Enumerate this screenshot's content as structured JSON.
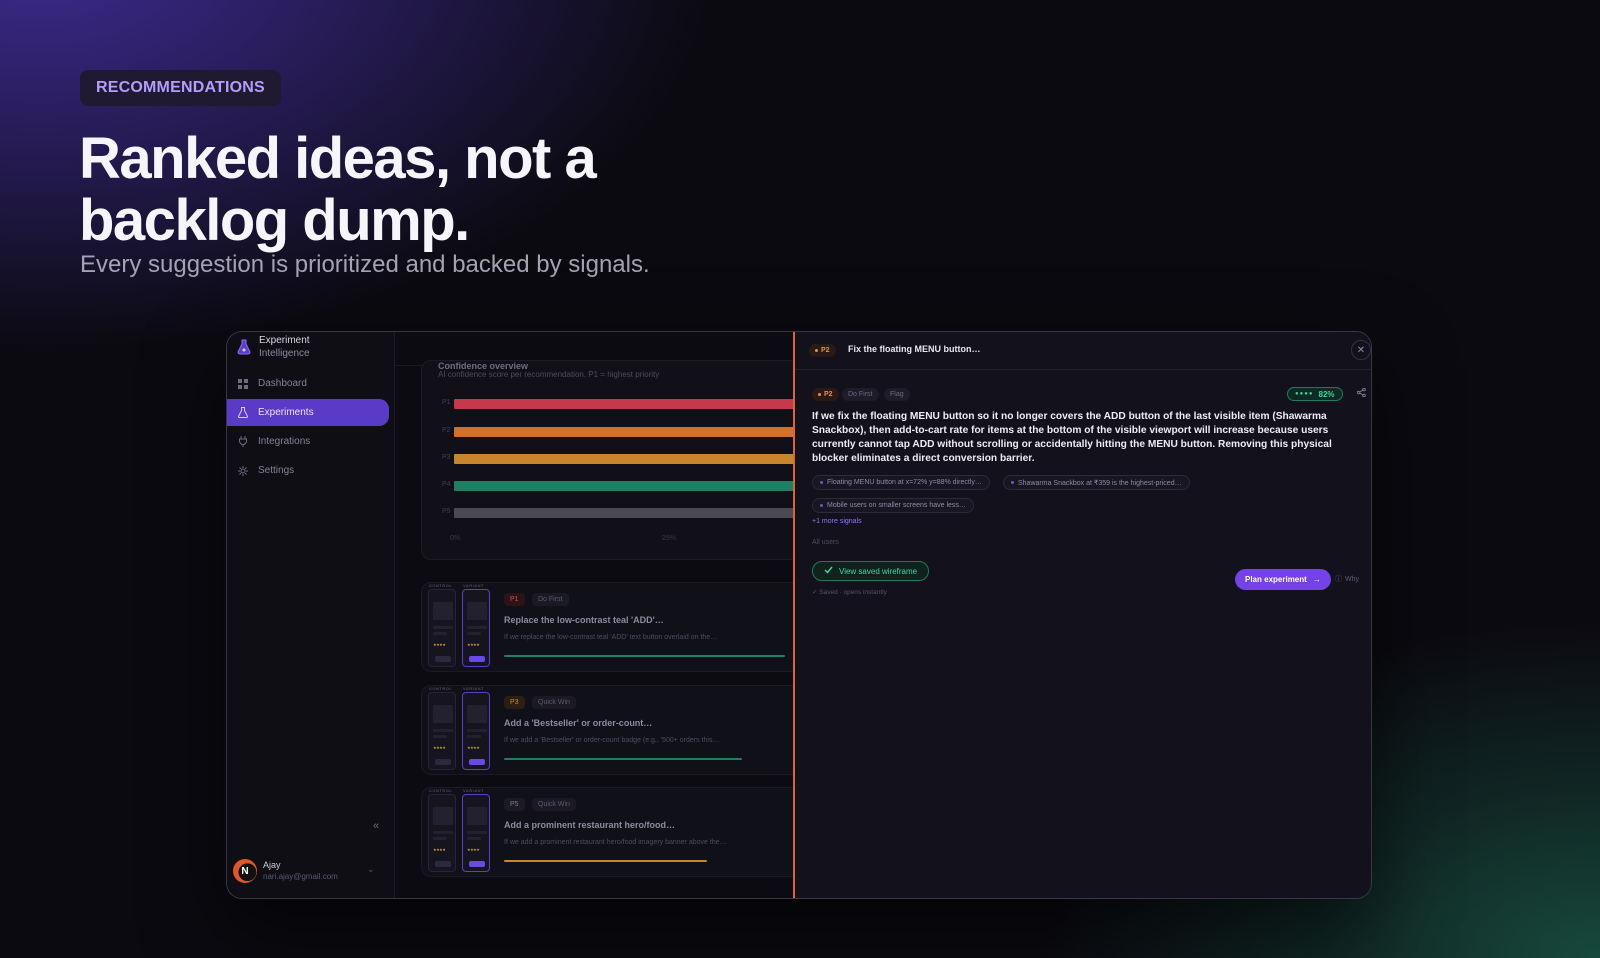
{
  "hero": {
    "badge": "RECOMMENDATIONS",
    "title_line1": "Ranked ideas, not a",
    "title_line2": "backlog dump.",
    "subtitle": "Every suggestion is prioritized and backed by signals."
  },
  "sidebar": {
    "brand_line1": "Experiment",
    "brand_line2": "Intelligence",
    "brand_icon": "flask-icon",
    "items": [
      {
        "label": "Dashboard",
        "icon": "grid-icon",
        "active": false
      },
      {
        "label": "Experiments",
        "icon": "flask-icon",
        "active": true
      },
      {
        "label": "Integrations",
        "icon": "plug-icon",
        "active": false
      },
      {
        "label": "Settings",
        "icon": "gear-icon",
        "active": false
      }
    ],
    "user": {
      "initial": "N",
      "name": "Ajay",
      "email": "nari.ajay@gmail.com"
    }
  },
  "confidence": {
    "title": "Confidence overview",
    "subtitle": "AI confidence score per recommendation. P1 = highest priority",
    "bars": [
      {
        "label": "P1",
        "color": "#c43a4a"
      },
      {
        "label": "P2",
        "color": "#d0702b"
      },
      {
        "label": "P3",
        "color": "#c8852b"
      },
      {
        "label": "P4",
        "color": "#1f7f63"
      },
      {
        "label": "P5",
        "color": "#4a4a55"
      }
    ],
    "ticks": [
      "0%",
      "25%"
    ]
  },
  "recommendations": [
    {
      "priority": "P1",
      "tag": "Do First",
      "title": "Replace the low-contrast teal 'ADD'…",
      "desc": "If we replace the low-contrast teal 'ADD' text button overlaid on the…",
      "progress": 0.97,
      "bar_color": "#1f7f63",
      "control_label": "CONTROL",
      "variant_label": "VARIANT",
      "control_btn": "ADD",
      "variant_btn": "ADD +"
    },
    {
      "priority": "P3",
      "tag": "Quick Win",
      "title": "Add a 'Bestseller' or order-count…",
      "desc": "If we add a 'Bestseller' or order-count badge (e.g., '500+ orders this…",
      "progress": 0.82,
      "bar_color": "#1f7f63",
      "control_label": "CONTROL",
      "variant_label": "VARIANT",
      "control_btn": "ADD",
      "variant_btn": "ADD +"
    },
    {
      "priority": "P5",
      "tag": "Quick Win",
      "title": "Add a prominent restaurant hero/food…",
      "desc": "If we add a prominent restaurant hero/food imagery banner above the…",
      "progress": 0.7,
      "bar_color": "#c8852b",
      "control_label": "CONTROL",
      "variant_label": "VARIANT",
      "control_btn": "ADD",
      "variant_btn": "ADD +"
    }
  ],
  "panel": {
    "priority": "P2",
    "header_title": "Fix the floating MENU button…",
    "tags": [
      "Do First",
      "Flag"
    ],
    "confidence": "82%",
    "hypothesis": "If we fix the floating MENU button so it no longer covers the ADD button of the last visible item (Shawarma Snackbox), then add-to-cart rate for items at the bottom of the visible viewport will increase because users currently cannot tap ADD without scrolling or accidentally hitting the MENU button. Removing this physical blocker eliminates a direct conversion barrier.",
    "signals": [
      "Floating MENU button at x=72% y=88% directly…",
      "Shawarma Snackbox at ₹359 is the highest-priced…",
      "Mobile users on smaller screens have less…"
    ],
    "more_signals": "+1 more signals",
    "audience": "All users",
    "wireframe_button": "View saved wireframe",
    "saved_note": "✓ Saved · opens instantly",
    "plan_button": "Plan experiment",
    "why": "Why",
    "colors": {
      "accent": "#7442e8",
      "p2": "#ef8a4d",
      "success": "#3ed3a0"
    }
  }
}
